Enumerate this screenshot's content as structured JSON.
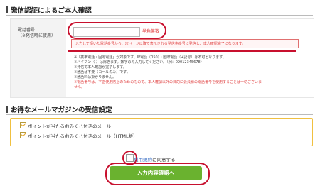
{
  "section1": {
    "title": "発信認証によるご本人確認",
    "field_label": "電話番号",
    "field_sublabel": "（※発信時に使用）",
    "input_value": "",
    "hint": "半角英数",
    "warning": "入力して頂いた電話番号から、次ページ以降で表示される発信先番号に発信し、本人確認完了になります。",
    "notes": [
      "※「携帯電話・固定電話」が対象です。IP電話（050）・国際電話（+記号）は不可となります。",
      "※ハイフン（-）は除きます。数字のみ入力してください。（例：09012345678）",
      "※発信で本人確認が完了します。",
      "※通話は不要（コールのみ）です。",
      "※通話料は掛かりません。"
    ],
    "notes_red": [
      "※電話番号は、不正使用防止のためのもので、本人確認以外の目的に会員様の電話番号を使用することは一切ございま",
      "せん。"
    ]
  },
  "section2": {
    "title": "お得なメールマガジンの受信設定",
    "options": [
      "ポイントが当たるおみくじ付きのメール",
      "ポイントが当たるおみくじ付きのメール（HTML版）"
    ]
  },
  "agreement": {
    "link_text": "利用規約",
    "suffix": "に同意する"
  },
  "submit_label": "入力内容確認へ",
  "colors": {
    "annotation": "#c8102e",
    "submit": "#6ab22f",
    "warning": "#e04040",
    "mag_border": "#f0c040"
  }
}
